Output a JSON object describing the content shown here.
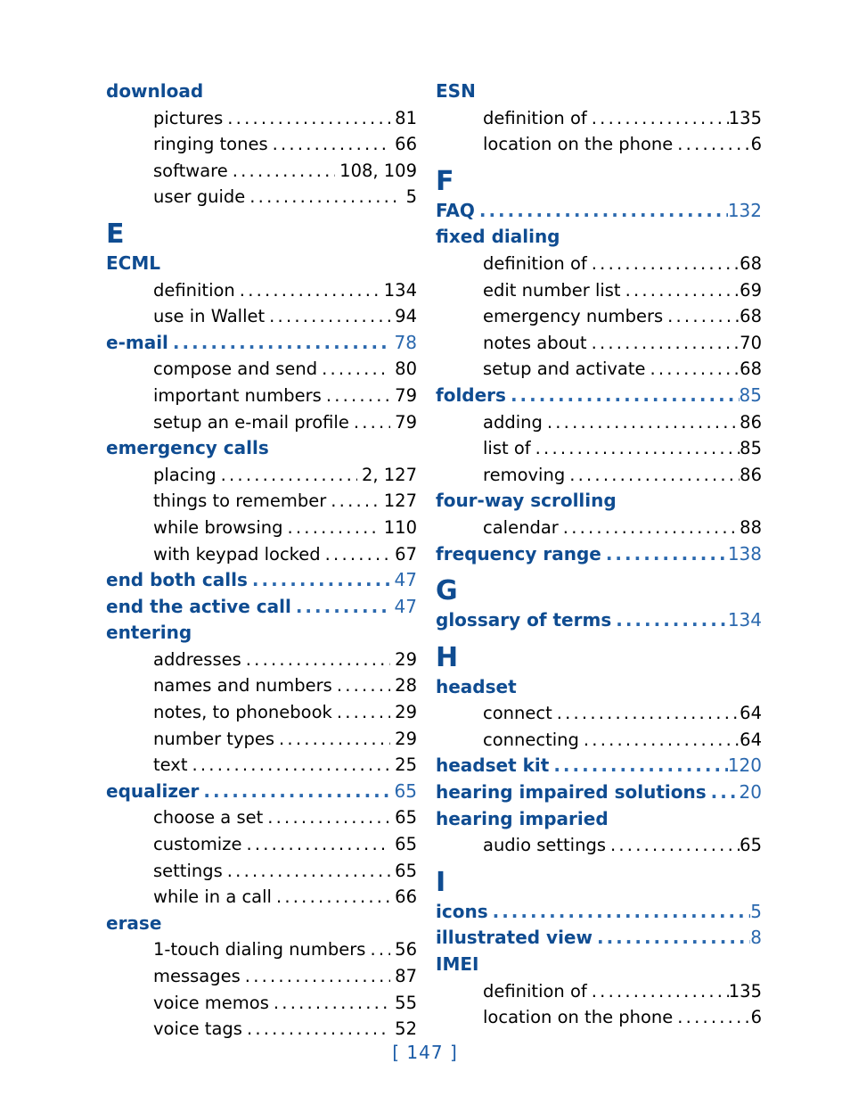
{
  "document": {
    "kind": "index",
    "folio": "[ 147 ]",
    "colors": {
      "heading_blue": "#0f4c91",
      "pageno_blue": "#2a68ae",
      "body_black": "#000000",
      "folio_blue": "#1b5ca8",
      "background": "#ffffff"
    }
  },
  "columns": [
    {
      "name": "left-column",
      "blocks": [
        {
          "type": "entry",
          "label": "download",
          "page": "",
          "subs": [
            {
              "label": "pictures",
              "page": "81"
            },
            {
              "label": "ringing tones",
              "page": "66"
            },
            {
              "label": "software",
              "page": "108, 109"
            },
            {
              "label": "user guide",
              "page": "5"
            }
          ]
        },
        {
          "type": "letter",
          "label": "E"
        },
        {
          "type": "entry",
          "label": "ECML",
          "page": "",
          "subs": [
            {
              "label": "definition",
              "page": "134"
            },
            {
              "label": "use in Wallet",
              "page": "94"
            }
          ]
        },
        {
          "type": "entry",
          "label": "e-mail",
          "page": "78",
          "subs": [
            {
              "label": "compose and send",
              "page": "80"
            },
            {
              "label": "important numbers",
              "page": "79"
            },
            {
              "label": "setup an e-mail profile",
              "page": "79"
            }
          ]
        },
        {
          "type": "entry",
          "label": "emergency calls",
          "page": "",
          "subs": [
            {
              "label": "placing",
              "page": "2, 127"
            },
            {
              "label": "things to remember",
              "page": "127"
            },
            {
              "label": "while browsing",
              "page": "110"
            },
            {
              "label": "with keypad locked",
              "page": "67"
            }
          ]
        },
        {
          "type": "entry",
          "label": "end both calls",
          "page": "47",
          "subs": []
        },
        {
          "type": "entry",
          "label": "end the active call",
          "page": "47",
          "subs": []
        },
        {
          "type": "entry",
          "label": "entering",
          "page": "",
          "subs": [
            {
              "label": "addresses",
              "page": "29"
            },
            {
              "label": "names and numbers",
              "page": "28"
            },
            {
              "label": "notes, to phonebook",
              "page": "29"
            },
            {
              "label": "number types",
              "page": "29"
            },
            {
              "label": "text",
              "page": "25"
            }
          ]
        },
        {
          "type": "entry",
          "label": "equalizer",
          "page": "65",
          "subs": [
            {
              "label": "choose a set",
              "page": "65"
            },
            {
              "label": "customize",
              "page": "65"
            },
            {
              "label": "settings",
              "page": "65"
            },
            {
              "label": "while in a call",
              "page": "66"
            }
          ]
        },
        {
          "type": "entry",
          "label": "erase",
          "page": "",
          "subs": [
            {
              "label": "1-touch dialing numbers",
              "page": "56"
            },
            {
              "label": "messages",
              "page": "87"
            },
            {
              "label": "voice memos",
              "page": "55"
            },
            {
              "label": "voice tags",
              "page": "52"
            }
          ]
        }
      ]
    },
    {
      "name": "right-column",
      "blocks": [
        {
          "type": "entry",
          "label": "ESN",
          "page": "",
          "subs": [
            {
              "label": "definition of",
              "page": "135"
            },
            {
              "label": "location on the phone",
              "page": "6"
            }
          ]
        },
        {
          "type": "letter",
          "label": "F"
        },
        {
          "type": "entry",
          "label": "FAQ",
          "page": "132",
          "subs": []
        },
        {
          "type": "entry",
          "label": "fixed dialing",
          "page": "",
          "subs": [
            {
              "label": "definition of",
              "page": "68"
            },
            {
              "label": "edit number list",
              "page": "69"
            },
            {
              "label": "emergency numbers",
              "page": "68"
            },
            {
              "label": "notes about",
              "page": "70"
            },
            {
              "label": "setup and activate",
              "page": "68"
            }
          ]
        },
        {
          "type": "entry",
          "label": "folders",
          "page": "85",
          "subs": [
            {
              "label": "adding",
              "page": "86"
            },
            {
              "label": "list of",
              "page": "85"
            },
            {
              "label": "removing",
              "page": "86"
            }
          ]
        },
        {
          "type": "entry",
          "label": "four-way scrolling",
          "page": "",
          "subs": [
            {
              "label": "calendar",
              "page": "88"
            }
          ]
        },
        {
          "type": "entry",
          "label": "frequency range",
          "page": "138",
          "subs": []
        },
        {
          "type": "letter",
          "label": "G"
        },
        {
          "type": "entry",
          "label": "glossary of terms",
          "page": "134",
          "subs": []
        },
        {
          "type": "letter",
          "label": "H"
        },
        {
          "type": "entry",
          "label": "headset",
          "page": "",
          "subs": [
            {
              "label": "connect",
              "page": "64"
            },
            {
              "label": "connecting",
              "page": "64"
            }
          ]
        },
        {
          "type": "entry",
          "label": "headset kit",
          "page": "120",
          "subs": []
        },
        {
          "type": "entry",
          "label": "hearing impaired solutions",
          "page": "20",
          "subs": []
        },
        {
          "type": "entry",
          "label": "hearing imparied",
          "page": "",
          "subs": [
            {
              "label": "audio settings",
              "page": "65"
            }
          ]
        },
        {
          "type": "letter",
          "label": "I"
        },
        {
          "type": "entry",
          "label": "icons",
          "page": "5",
          "subs": []
        },
        {
          "type": "entry",
          "label": "illustrated view",
          "page": "8",
          "subs": []
        },
        {
          "type": "entry",
          "label": "IMEI",
          "page": "",
          "subs": [
            {
              "label": "definition of",
              "page": "135"
            },
            {
              "label": "location on the phone",
              "page": "6"
            }
          ]
        }
      ]
    }
  ]
}
